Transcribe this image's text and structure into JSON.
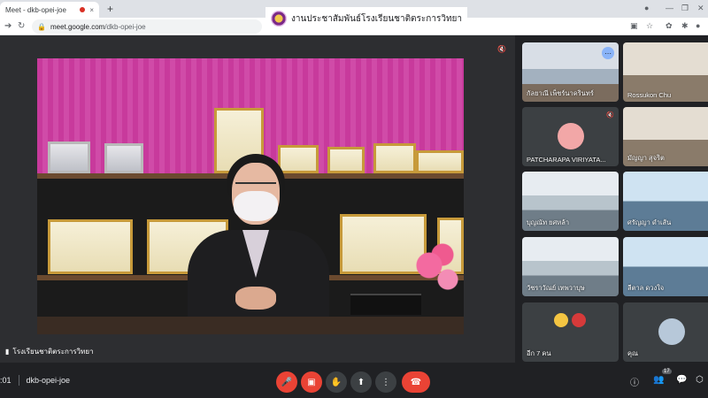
{
  "browser": {
    "tab_title": "Meet - dkb-opei-joe",
    "tab_close": "×",
    "new_tab": "+",
    "url_host": "meet.google.com",
    "url_path": "/dkb-opei-joe",
    "banner_text": "งานประชาสัมพันธ์โรงเรียนชาติตระการวิทยา"
  },
  "main_tile": {
    "presenter_name": "โรงเรียนชาติตระการวิทยา"
  },
  "grid": [
    {
      "label": "กัลยาณี เพ็ชร์นาครินทร์",
      "scene": "room",
      "more": true
    },
    {
      "label": "Rossukon Chu",
      "scene": "office",
      "more": false
    },
    {
      "label": "PATCHARAPA VIRIYATA...",
      "scene": "avatar",
      "more": false
    },
    {
      "label": "มัญญา สุจริต",
      "scene": "office",
      "more": false
    },
    {
      "label": "บุญณัท ยศหล้า",
      "scene": "hall",
      "more": false
    },
    {
      "label": "ศรัญญา ดำเส้น",
      "scene": "blue",
      "more": false
    },
    {
      "label": "วัชราวัณย์ เทพวาบุษ",
      "scene": "hall",
      "more": false
    },
    {
      "label": "ลีตาล ดวงใจ",
      "scene": "blue",
      "more": false
    },
    {
      "label": "อีก 7 คน",
      "scene": "logos",
      "more": false
    },
    {
      "label": "คุณ",
      "scene": "self",
      "more": false
    }
  ],
  "bottom": {
    "time": ":01",
    "meeting_code": "dkb-opei-joe",
    "participant_count": "17"
  },
  "colors": {
    "hangup": "#ea4335",
    "background": "#202124",
    "accent_blue": "#8ab4f8"
  }
}
